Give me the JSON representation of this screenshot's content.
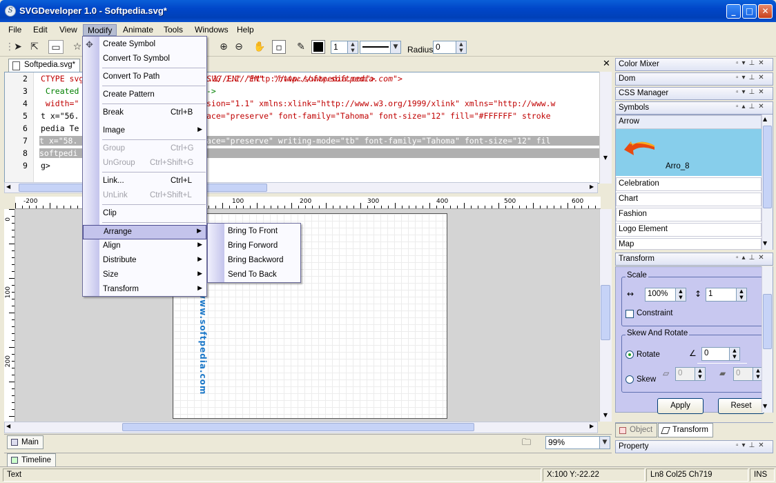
{
  "window": {
    "title": "SVGDeveloper 1.0 - Softpedia.svg*"
  },
  "menubar": [
    "File",
    "Edit",
    "View",
    "Modify",
    "Animate",
    "Tools",
    "Windows",
    "Help"
  ],
  "toolbar": {
    "stroke_width": "1",
    "radius_label": "Radius",
    "radius_value": "0"
  },
  "doc_tab": "Softpedia.svg*",
  "code": {
    "line_numbers": [
      "2",
      "3",
      "4",
      "5",
      "6",
      "7",
      "8",
      "9"
    ],
    "lines": [
      "CTYPE svg PUBLIC \"-//W3C//DTD SVG 1.1//EN\" \"http://www.softpedia.com\">",
      " Created",
      " width=\"",
      "t x=\"56.",
      "pedia Te",
      "t x=\"58.",
      "softpedi",
      "g>"
    ],
    "right_fragments": [
      "SVG 1.1//EN\"  \"http://www.softpedia.com\">",
      "->",
      "sion=\"1.1\" xmlns:xlink=\"http://www.w3.org/1999/xlink\" xmlns=\"http://www.w",
      "ace=\"preserve\" font-family=\"Tahoma\" font-size=\"12\" fill=\"#FFFFFF\" stroke",
      "",
      "ace=\"preserve\" writing-mode=\"tb\" font-family=\"Tahoma\" font-size=\"12\" fil",
      "",
      ""
    ]
  },
  "ruler_h": [
    "-200",
    "100",
    "200",
    "300",
    "400",
    "500",
    "600"
  ],
  "ruler_v": [
    "0",
    "100",
    "200"
  ],
  "canvas_text": "www.softpedia.com",
  "bottom": {
    "main_tab": "Main",
    "zoom": "99%",
    "timeline_tab": "Timeline"
  },
  "status": {
    "mode": "Text",
    "coords": "X:100  Y:-22.22",
    "pos": "Ln8  Col25  Ch719",
    "ins": "INS"
  },
  "panels": {
    "headers": [
      "Color Mixer",
      "Dom",
      "CSS Manager",
      "Symbols"
    ],
    "symbols": {
      "selected": "Arrow",
      "preview_label": "Arro_8",
      "items": [
        "Celebration",
        "Chart",
        "Fashion",
        "Logo Element",
        "Map"
      ]
    },
    "transform": {
      "title": "Transform",
      "scale_label": "Scale",
      "scale_x": "100%",
      "scale_y": "1",
      "constraint": "Constraint",
      "skew_rotate_label": "Skew And Rotate",
      "rotate_label": "Rotate",
      "rotate_value": "0",
      "skew_label": "Skew",
      "skew_x": "0",
      "skew_y": "0",
      "apply": "Apply",
      "reset": "Reset"
    },
    "bottom_tabs": [
      "Object",
      "Transform"
    ],
    "property": "Property"
  },
  "modify_menu": [
    {
      "label": "Create Symbol",
      "shortcut": "",
      "enabled": true
    },
    {
      "label": "Convert To Symbol",
      "shortcut": "",
      "enabled": true
    },
    {
      "label": "Convert To Path",
      "shortcut": "",
      "enabled": true
    },
    {
      "label": "Create Pattern",
      "shortcut": "",
      "enabled": true
    },
    {
      "label": "Break",
      "shortcut": "Ctrl+B",
      "enabled": true
    },
    {
      "label": "Image",
      "shortcut": "",
      "enabled": true
    },
    {
      "label": "Group",
      "shortcut": "Ctrl+G",
      "enabled": false
    },
    {
      "label": "UnGroup",
      "shortcut": "Ctrl+Shift+G",
      "enabled": false
    },
    {
      "label": "Link...",
      "shortcut": "Ctrl+L",
      "enabled": true
    },
    {
      "label": "UnLink",
      "shortcut": "Ctrl+Shift+L",
      "enabled": false
    },
    {
      "label": "Clip",
      "shortcut": "",
      "enabled": true
    },
    {
      "label": "Arrange",
      "shortcut": "",
      "enabled": true
    },
    {
      "label": "Align",
      "shortcut": "",
      "enabled": true
    },
    {
      "label": "Distribute",
      "shortcut": "",
      "enabled": true
    },
    {
      "label": "Size",
      "shortcut": "",
      "enabled": true
    },
    {
      "label": "Transform",
      "shortcut": "",
      "enabled": true
    }
  ],
  "arrange_submenu": [
    "Bring To Front",
    "Bring Forword",
    "Bring Backword",
    "Send To Back"
  ]
}
